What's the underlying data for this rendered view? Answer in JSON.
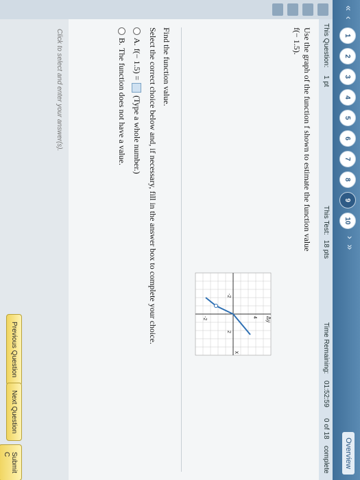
{
  "nav": {
    "arrows_left": "«  ‹",
    "arrows_right": "›  »",
    "question_numbers": [
      "1",
      "2",
      "3",
      "4",
      "5",
      "6",
      "7",
      "8",
      "9",
      "10"
    ],
    "current": "9",
    "overview": "Overview"
  },
  "info": {
    "this_question_label": "This Question:",
    "this_question_value": "1 pt",
    "this_test_label": "This Test:",
    "this_test_value": "18 pts",
    "time_label": "Time Remaining:",
    "time_value": "01:52:59",
    "progress": "0 of 18",
    "complete": "complete"
  },
  "question": {
    "prompt_line1": "Use the graph of the function f shown to estimate the function value",
    "prompt_line2": "f(− 1.5).",
    "find": "Find the function value.",
    "select": "Select the correct choice below and, if necessary, fill in the answer box to complete your choice.",
    "optionA_label": "A.",
    "optionA_text_pre": "f(− 1.5) =",
    "optionA_text_post": "(Type a whole number.)",
    "optionB_label": "B.",
    "optionB_text": "The function does not have a value."
  },
  "graph": {
    "x_label": "x",
    "y_label": "Δy",
    "tick_pos": "4",
    "tick_neg": "-2",
    "tick_pos2": "2",
    "tick_neg2": "-2"
  },
  "bottom": {
    "hint": "Click to select and enter your answer(s).",
    "previous": "Previous Question",
    "next": "Next Question",
    "submit": "Submit C"
  }
}
